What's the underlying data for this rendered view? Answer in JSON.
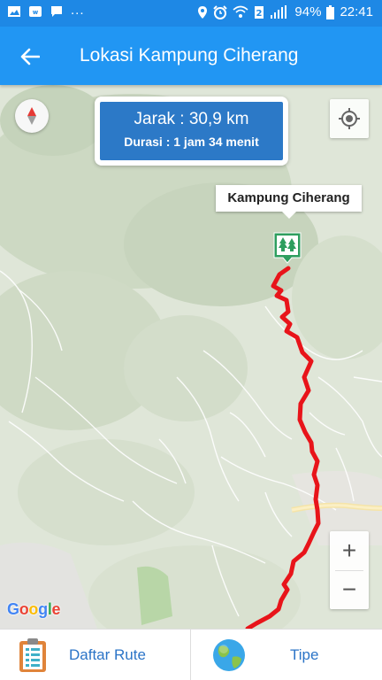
{
  "status_bar": {
    "left_icons": [
      "image-icon",
      "app-badge-icon",
      "chat-icon"
    ],
    "more": "...",
    "right_icons": [
      "location-icon",
      "alarm-icon",
      "wifi-icon",
      "sim2-icon",
      "signal-icon"
    ],
    "battery": "94%",
    "time": "22:41"
  },
  "app_bar": {
    "title": "Lokasi Kampung Ciherang",
    "back_icon": "arrow-back-icon"
  },
  "map": {
    "route_color": "#e8141a",
    "info": {
      "distance": "Jarak : 30,9 km",
      "duration": "Durasi : 1 jam 34 menit"
    },
    "destination_label": "Kampung Ciherang",
    "marker_icon": "forest-icon",
    "zoom_in": "+",
    "zoom_out": "−",
    "attribution": "Google"
  },
  "bottom_bar": {
    "route_list_label": "Daftar Rute",
    "type_label": "Tipe"
  }
}
